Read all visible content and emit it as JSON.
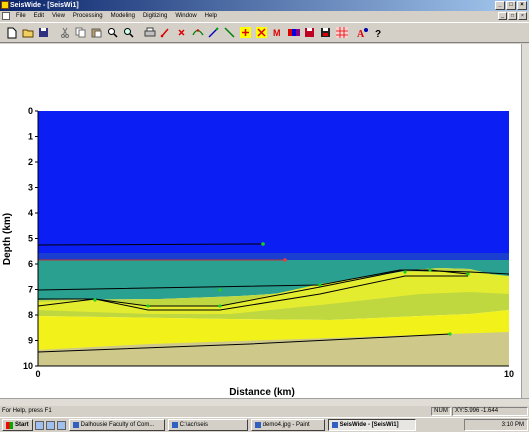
{
  "window": {
    "title": "SeisWide - [SeisWi1]",
    "controls": [
      "_",
      "□",
      "×"
    ]
  },
  "menu": {
    "items": [
      "File",
      "Edit",
      "View",
      "Processing",
      "Modeling",
      "Digitizing",
      "Window",
      "Help"
    ],
    "doc_controls": [
      "_",
      "□",
      "×"
    ]
  },
  "toolbar": {
    "icons": [
      "new-file-icon",
      "open-folder-icon",
      "save-icon",
      "cut-icon",
      "copy-icon",
      "paste-icon",
      "zoom-icon",
      "zoom-in-icon",
      "print-icon",
      "pick-red-icon",
      "point-red-icon",
      "curve-icon",
      "line-green-icon",
      "line-yellow-icon",
      "plus-icon",
      "cross-icon",
      "marker-m-icon",
      "colorbar-icon",
      "disk-red-icon",
      "disk-save-icon",
      "grid-icon",
      "font-icon",
      "help-icon"
    ]
  },
  "plot": {
    "ylabel": "Depth (km)",
    "xlabel": "Distance (km)",
    "yticks": [
      "0",
      "1",
      "2",
      "3",
      "4",
      "5",
      "6",
      "7",
      "8",
      "9",
      "10"
    ],
    "xticks": [
      "0",
      "10"
    ],
    "colors": {
      "water": "#0b1ef4",
      "teal": "#2aa090",
      "yellow": "#f2f21a",
      "olive": "#cec98a"
    }
  },
  "status": {
    "help": "For Help, press F1",
    "num": "NUM",
    "coords": "XY:5.996 -1.644"
  },
  "taskbar": {
    "start": "Start",
    "tasks": [
      {
        "label": "Dalhousie Faculty of Com...",
        "active": false
      },
      {
        "label": "C:\\acr\\seis",
        "active": false
      },
      {
        "label": "demo4.jpg - Paint",
        "active": false
      },
      {
        "label": "SeisWide - [SeisWi1]",
        "active": true
      }
    ],
    "clock": "3:10 PM"
  }
}
